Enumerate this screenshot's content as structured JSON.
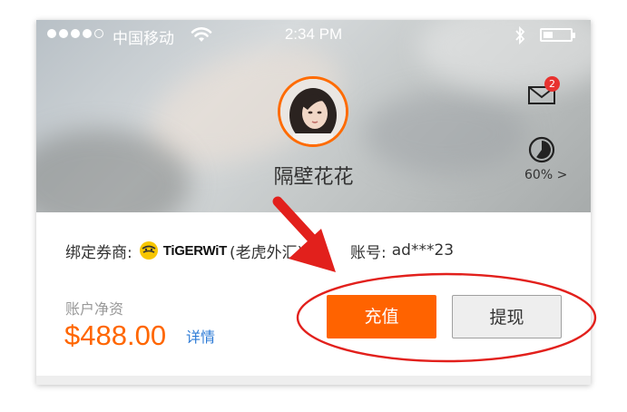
{
  "status_bar": {
    "carrier": "中国移动",
    "time": "2:34 PM"
  },
  "profile": {
    "username": "隔壁花花"
  },
  "header_icons": {
    "mail_badge": "2",
    "progress_percent": 60,
    "progress_label": "60% >"
  },
  "account": {
    "broker_label": "绑定券商:",
    "broker_name": "TiGERWiT",
    "broker_cn": "(老虎外汇)",
    "account_label": "账号:",
    "account_value": "ad***23",
    "balance_label": "账户净资",
    "balance_value": "$488.00",
    "detail_link": "详情"
  },
  "buttons": {
    "recharge": "充值",
    "withdraw": "提现"
  },
  "colors": {
    "accent_orange": "#ff6300",
    "annotation_red": "#e2201c",
    "link_blue": "#2e7bd6"
  }
}
